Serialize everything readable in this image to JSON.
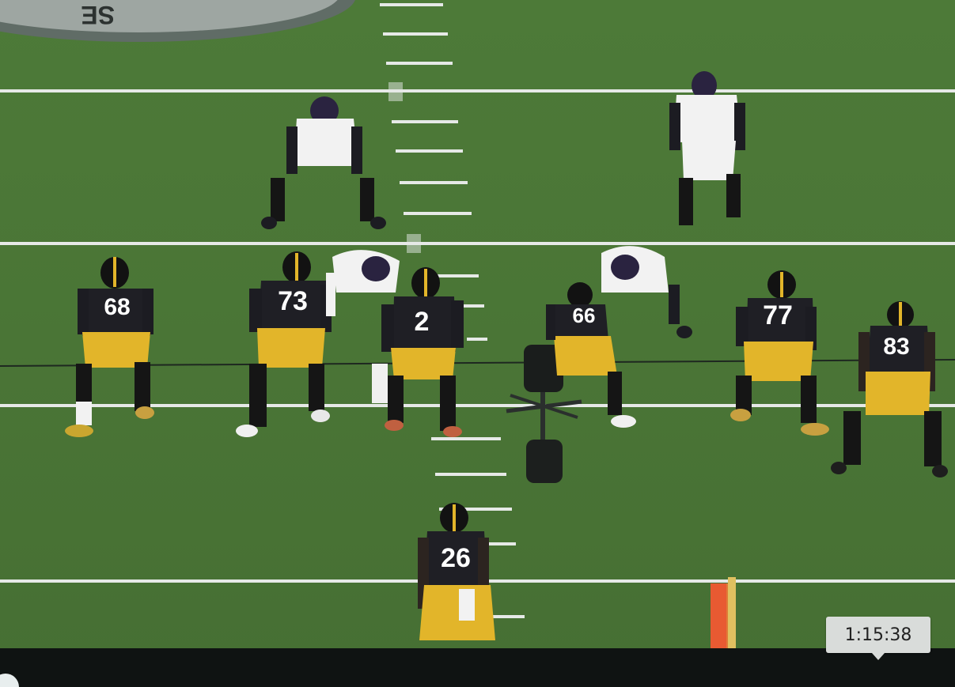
{
  "scene": {
    "description_free": true,
    "colors": {
      "grass": "#4f7a3a",
      "grass_dark": "#456e32",
      "yard_line": "#e9ecea",
      "home_jersey": "#1c1c22",
      "home_pants": "#e2b52a",
      "away_jersey": "#f2f2f2",
      "helmet_away": "#2a2340"
    },
    "logo_text": "SE",
    "players": [
      {
        "team": "home",
        "number": "68"
      },
      {
        "team": "home",
        "number": "73"
      },
      {
        "team": "home",
        "number": "2"
      },
      {
        "team": "home",
        "number": "66"
      },
      {
        "team": "home",
        "number": "77"
      },
      {
        "team": "home",
        "number": "83"
      },
      {
        "team": "home",
        "number": "26"
      },
      {
        "team": "away",
        "number": ""
      },
      {
        "team": "away",
        "number": ""
      },
      {
        "team": "away",
        "number": ""
      },
      {
        "team": "away",
        "number": ""
      }
    ]
  },
  "player": {
    "timestamp": "1:15:38",
    "icons": [
      "play-icon"
    ]
  }
}
